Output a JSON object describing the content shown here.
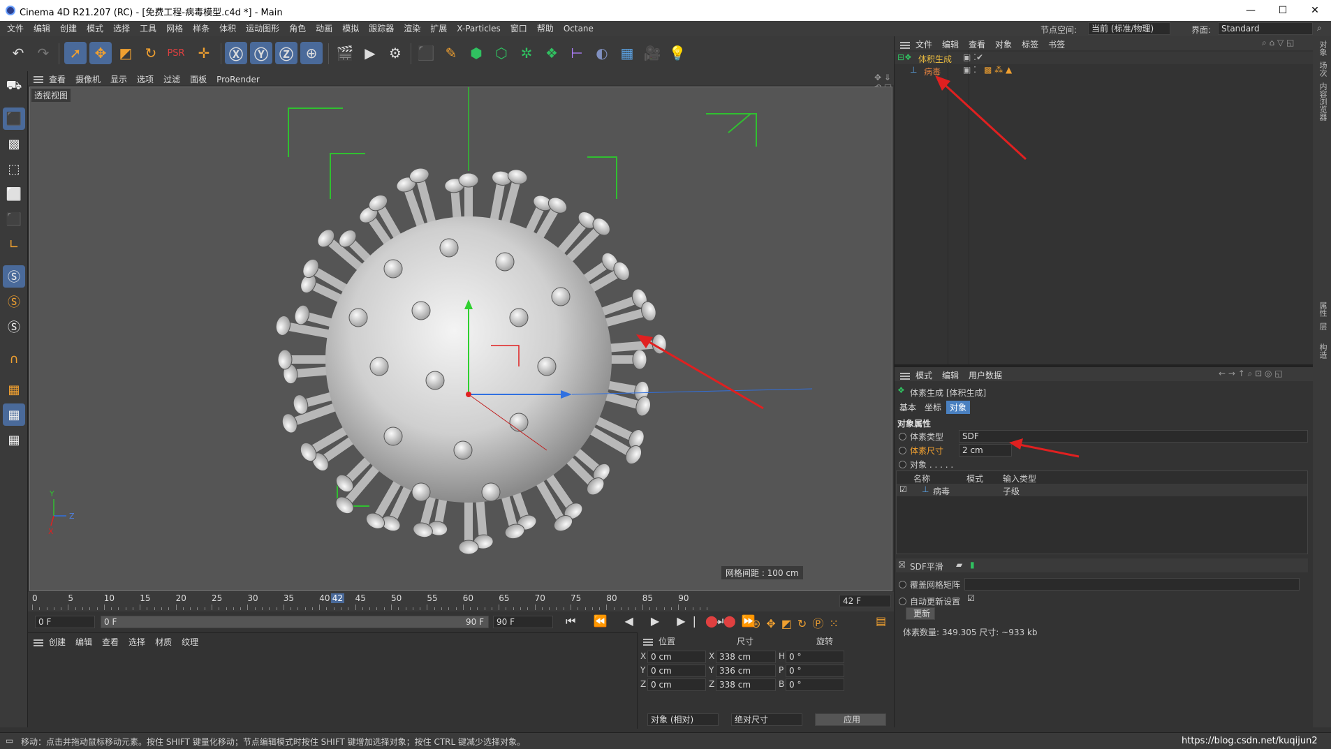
{
  "window": {
    "title": "Cinema 4D R21.207 (RC) - [免费工程-病毒模型.c4d *] - Main",
    "min": "—",
    "max": "☐",
    "close": "✕"
  },
  "menu": [
    "文件",
    "编辑",
    "创建",
    "模式",
    "选择",
    "工具",
    "网格",
    "样条",
    "体积",
    "运动图形",
    "角色",
    "动画",
    "模拟",
    "跟踪器",
    "渲染",
    "扩展",
    "X-Particles",
    "窗口",
    "帮助",
    "Octane"
  ],
  "nodespace": {
    "label": "节点空间:",
    "value": "当前 (标准/物理)"
  },
  "layout": {
    "label": "界面:",
    "value": "Standard"
  },
  "viewport": {
    "menu": [
      "查看",
      "摄像机",
      "显示",
      "选项",
      "过滤",
      "面板",
      "ProRender"
    ],
    "label": "透视视图",
    "grid_spacing": "网格间距 : 100 cm",
    "axis": {
      "y": "Y",
      "z": "Z",
      "x": "X"
    }
  },
  "timeline": {
    "ticks": [
      "0",
      "5",
      "10",
      "15",
      "20",
      "25",
      "30",
      "35",
      "40",
      "45",
      "50",
      "55",
      "60",
      "65",
      "70",
      "75",
      "80",
      "85",
      "90"
    ],
    "current_marker": "42",
    "current_frame": "42 F",
    "start": "0 F",
    "range_start": "0 F",
    "range_end": "90 F",
    "end": "90 F"
  },
  "material_panel": {
    "menu": [
      "创建",
      "编辑",
      "查看",
      "选择",
      "材质",
      "纹理"
    ]
  },
  "coords": {
    "headers": [
      "位置",
      "尺寸",
      "旋转"
    ],
    "rows": [
      {
        "axis": "X",
        "pos": "0 cm",
        "saxis": "X",
        "size": "338 cm",
        "raxis": "H",
        "rot": "0 °"
      },
      {
        "axis": "Y",
        "pos": "0 cm",
        "saxis": "Y",
        "size": "336 cm",
        "raxis": "P",
        "rot": "0 °"
      },
      {
        "axis": "Z",
        "pos": "0 cm",
        "saxis": "Z",
        "size": "338 cm",
        "raxis": "B",
        "rot": "0 °"
      }
    ],
    "mode": "对象 (相对)",
    "size_mode": "绝对尺寸",
    "apply": "应用"
  },
  "object_manager": {
    "menu": [
      "文件",
      "编辑",
      "查看",
      "对象",
      "标签",
      "书签"
    ],
    "items": [
      {
        "name": "体积生成",
        "color": "#f0c040"
      },
      {
        "name": "病毒",
        "color": "#e08040"
      }
    ]
  },
  "attributes": {
    "menu": [
      "模式",
      "编辑",
      "用户数据"
    ],
    "title": "体素生成 [体积生成]",
    "tabs": [
      "基本",
      "坐标",
      "对象"
    ],
    "section": "对象属性",
    "voxel_type_label": "体素类型",
    "voxel_type": "SDF",
    "voxel_size_label": "体素尺寸",
    "voxel_size": "2 cm",
    "objects_label": "对象 . . . . .",
    "table_headers": [
      "名称",
      "模式",
      "输入类型"
    ],
    "table_row": {
      "name": "病毒",
      "input_type": "子级"
    },
    "sdf_label": "SDF平滑",
    "override_label": "覆盖网格矩阵",
    "auto_update_label": "自动更新设置",
    "update_btn": "更新",
    "stats": "体素数量: 349.305   尺寸: ~933 kb"
  },
  "side_tabs": [
    "对象",
    "场次",
    "内容浏览器",
    "属性",
    "层",
    "构造"
  ],
  "status": "移动：点击并拖动鼠标移动元素。按住 SHIFT 键量化移动；节点编辑模式时按住 SHIFT 键增加选择对象；按住 CTRL 键减少选择对象。",
  "watermark": "https://blog.csdn.net/kuqijun2"
}
